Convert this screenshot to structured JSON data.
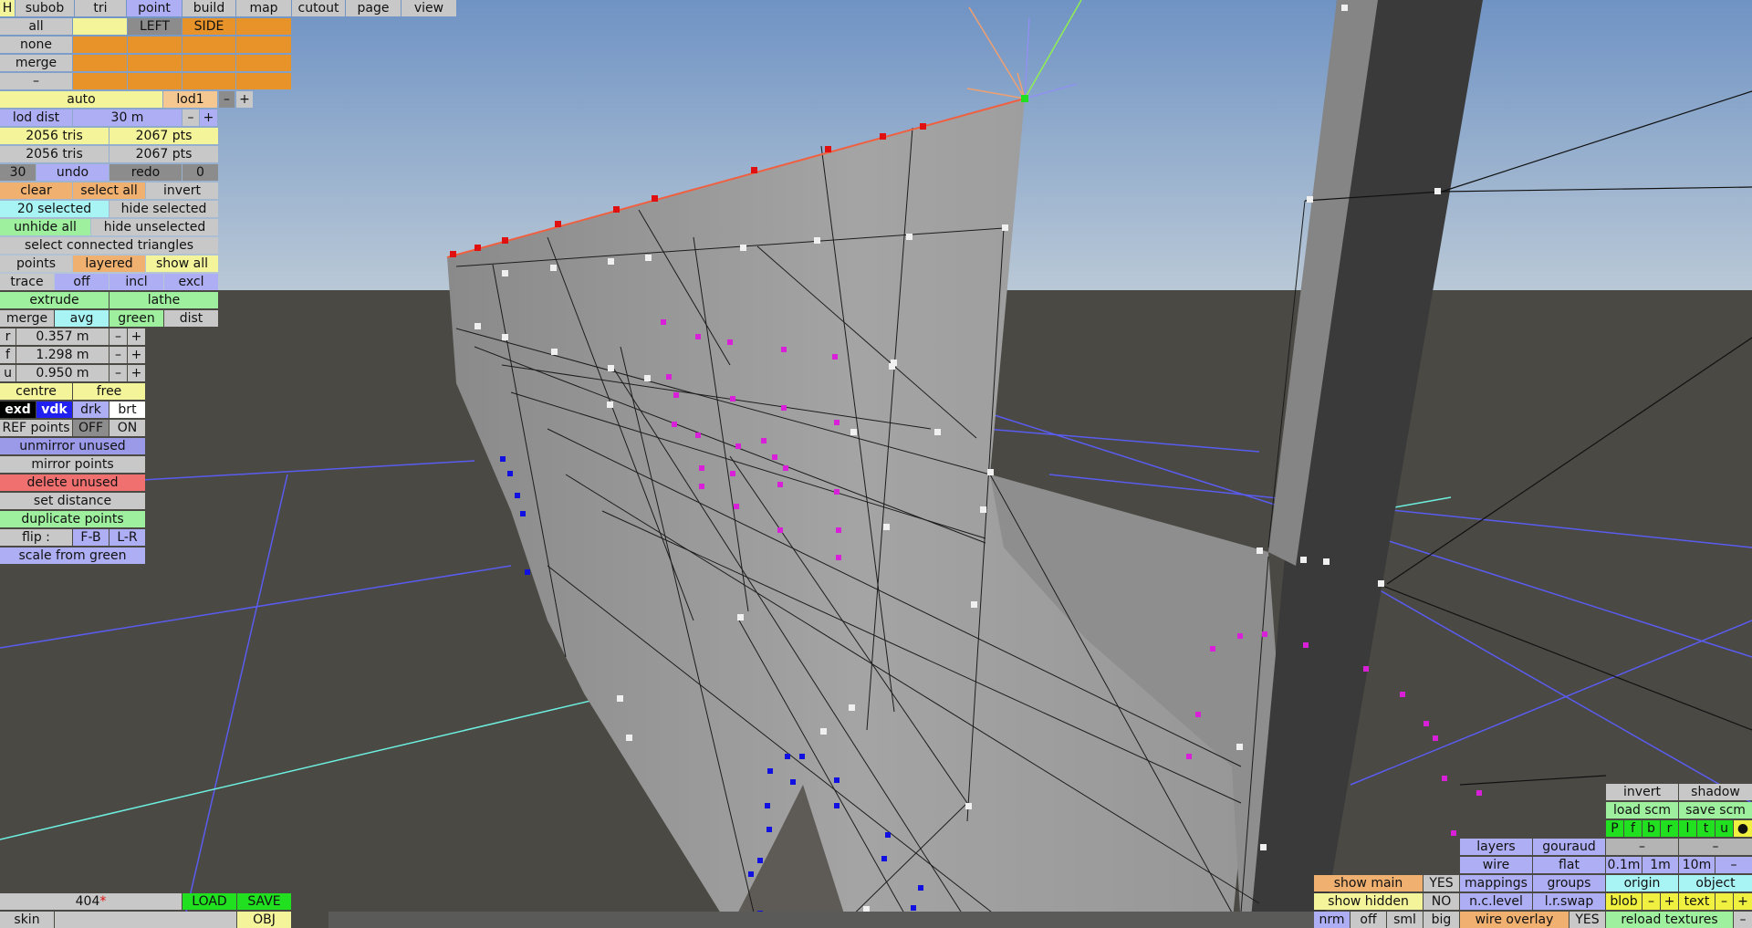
{
  "app": {
    "menu": {
      "h": "H",
      "items": [
        "subob",
        "tri",
        "point",
        "build",
        "map",
        "cutout",
        "page",
        "view"
      ],
      "active": "point"
    },
    "view_select": {
      "all": "all",
      "none": "none",
      "merge": "merge",
      "dash": "–",
      "left": "LEFT",
      "side": "SIDE"
    },
    "lod": {
      "auto": "auto",
      "lod_name": "lod1",
      "minus": "–",
      "plus": "+",
      "dist_label": "lod dist",
      "dist_value": "30 m"
    },
    "stats": {
      "tris1": "2056 tris",
      "pts1": "2067 pts",
      "tris2": "2056 tris",
      "pts2": "2067 pts"
    },
    "undo": {
      "count": "30",
      "undo": "undo",
      "redo": "redo",
      "redo_count": "0"
    },
    "selection": {
      "clear": "clear",
      "select_all": "select all",
      "invert": "invert",
      "selected": "20 selected",
      "hide_selected": "hide selected",
      "unhide_all": "unhide all",
      "hide_unselected": "hide unselected",
      "select_connected": "select connected triangles"
    },
    "display": {
      "points": "points",
      "layered": "layered",
      "show_all": "show all"
    },
    "trace": {
      "label": "trace",
      "off": "off",
      "incl": "incl",
      "excl": "excl"
    },
    "build": {
      "extrude": "extrude",
      "lathe": "lathe"
    },
    "merge_row": {
      "merge": "merge",
      "avg": "avg",
      "green": "green",
      "dist": "dist"
    },
    "coords": [
      {
        "axis": "r",
        "value": "0.357 m"
      },
      {
        "axis": "f",
        "value": "1.298 m"
      },
      {
        "axis": "u",
        "value": "0.950 m"
      }
    ],
    "pivot": {
      "centre": "centre",
      "free": "free"
    },
    "ref": {
      "exd": "exd",
      "vdk": "vdk",
      "drk": "drk",
      "brt": "brt",
      "ref_points": "REF points",
      "off": "OFF",
      "on": "ON"
    },
    "actions": {
      "unmirror_unused": "unmirror unused",
      "mirror_points": "mirror points",
      "delete_unused": "delete unused",
      "set_distance": "set distance",
      "duplicate_points": "duplicate points",
      "flip": "flip :",
      "flip_fb": "F-B",
      "flip_lr": "L-R",
      "scale_from_green": "scale from green"
    },
    "bottom_left": {
      "count": "404",
      "star": "*",
      "load": "LOAD",
      "save": "SAVE",
      "skin": "skin",
      "obj": "OBJ"
    },
    "bottom_right": {
      "show_main": "show main",
      "yes1": "YES",
      "show_hidden": "show hidden",
      "no": "NO",
      "nrm": "nrm",
      "off": "off",
      "sml": "sml",
      "big": "big",
      "layers": "layers",
      "gouraud": "gouraud",
      "wire": "wire",
      "flat": "flat",
      "mappings": "mappings",
      "groups": "groups",
      "nc_level": "n.c.level",
      "lr_swap": "l.r.swap",
      "wire_overlay": "wire overlay",
      "yes2": "YES",
      "invert": "invert",
      "shadow": "shadow",
      "load_scm": "load scm",
      "save_scm": "save scm",
      "flags": [
        "P",
        "f",
        "b",
        "r",
        "l",
        "t",
        "u"
      ],
      "dash": "–",
      "dash2": "–",
      "d01": "0.1m",
      "d1": "1m",
      "d10": "10m",
      "dminus": "–",
      "origin": "origin",
      "object": "object",
      "blob": "blob",
      "bminus": "–",
      "bplus": "+",
      "text": "text",
      "tminus": "–",
      "tplus": "+",
      "reload_textures": "reload textures",
      "rminus": "–"
    }
  }
}
